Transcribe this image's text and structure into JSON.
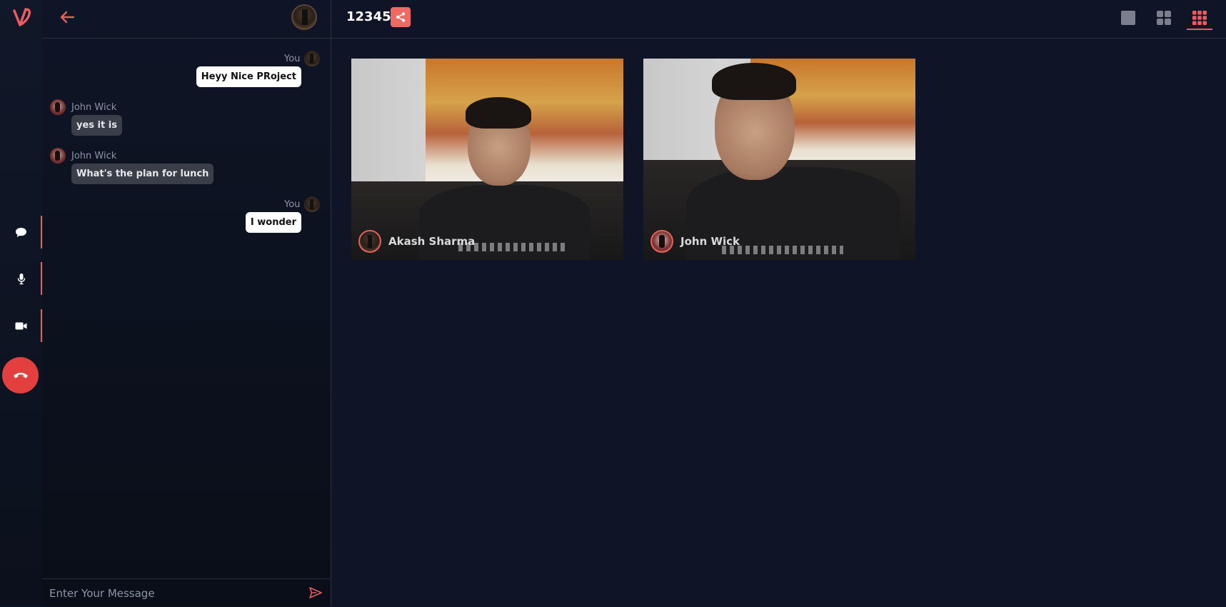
{
  "app": {
    "logo_icon": "v-logo-icon",
    "accent_color": "#e0625b",
    "end_call_color": "#e43f3f"
  },
  "rail": {
    "buttons": [
      {
        "id": "chat",
        "icon": "chat-bubble-icon"
      },
      {
        "id": "mic",
        "icon": "microphone-icon"
      },
      {
        "id": "camera",
        "icon": "video-camera-icon"
      },
      {
        "id": "end-call",
        "icon": "phone-hangup-icon"
      }
    ]
  },
  "chat": {
    "messages": [
      {
        "sender": "You",
        "text": "Heyy Nice PRoject",
        "mine": true
      },
      {
        "sender": "John Wick",
        "text": "yes it is",
        "mine": false
      },
      {
        "sender": "John Wick",
        "text": "What's the plan for lunch",
        "mine": false
      },
      {
        "sender": "You",
        "text": "I wonder",
        "mine": true
      }
    ],
    "input_placeholder": "Enter Your Message"
  },
  "room": {
    "id": "12345"
  },
  "participants": [
    {
      "name": "Akash Sharma"
    },
    {
      "name": "John Wick"
    }
  ]
}
